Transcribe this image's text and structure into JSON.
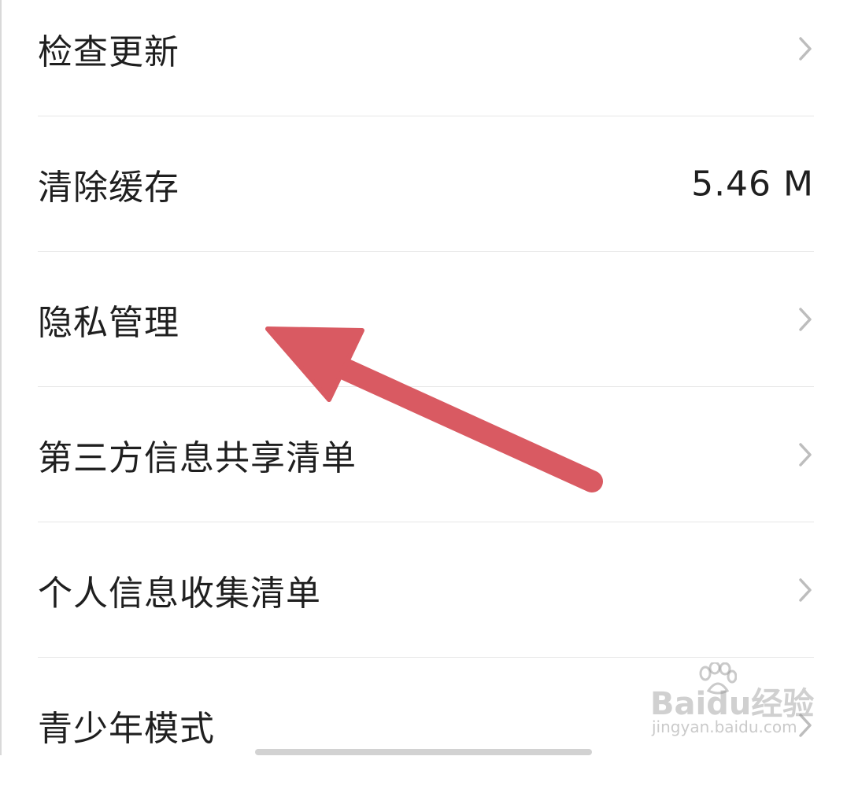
{
  "settings": {
    "items": [
      {
        "label": "检查更新",
        "value": "",
        "has_chevron": true
      },
      {
        "label": "清除缓存",
        "value": "5.46 M",
        "has_chevron": false
      },
      {
        "label": "隐私管理",
        "value": "",
        "has_chevron": true
      },
      {
        "label": "第三方信息共享清单",
        "value": "",
        "has_chevron": true
      },
      {
        "label": "个人信息收集清单",
        "value": "",
        "has_chevron": true
      },
      {
        "label": "青少年模式",
        "value": "",
        "has_chevron": true
      }
    ]
  },
  "annotation": {
    "arrow_color": "#d95a62",
    "arrow_icon": "red-arrow-icon"
  },
  "watermark": {
    "brand": "Baidu经验",
    "url": "jingyan.baidu.com",
    "icon": "baidu-paw-icon"
  },
  "colors": {
    "text": "#1f1f1f",
    "divider": "#e6e6e6",
    "chevron": "#bdbdbd",
    "background": "#ffffff"
  }
}
